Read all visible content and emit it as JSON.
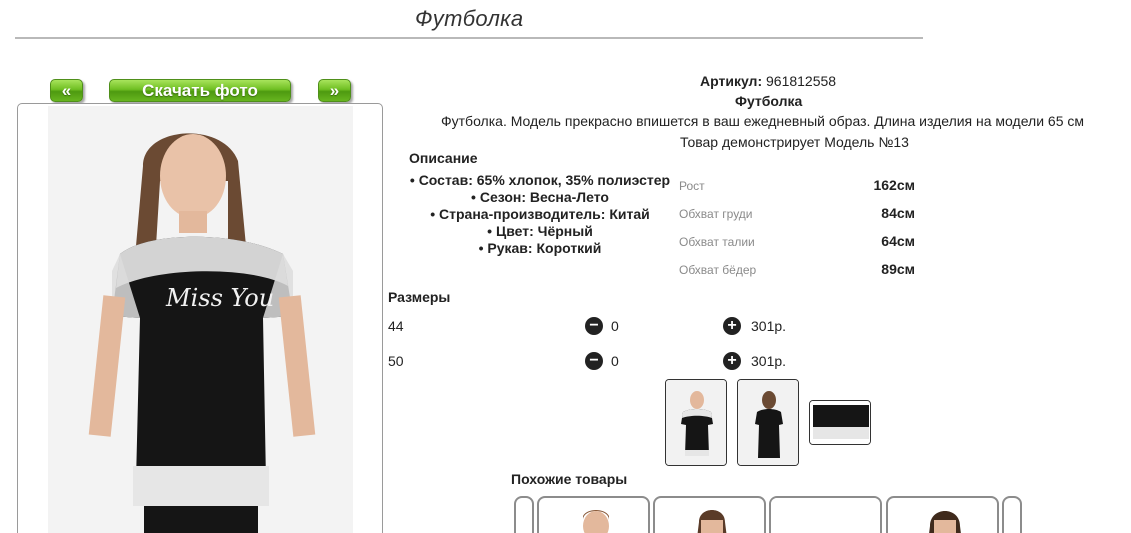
{
  "page": {
    "title": "Футболка"
  },
  "gallery": {
    "prev_label": "«",
    "download_label": "Скачать фото",
    "next_label": "»"
  },
  "product": {
    "article_label": "Артикул:",
    "article_value": "961812558",
    "name": "Футболка",
    "description": "Футболка. Модель прекрасно впишется в ваш ежедневный образ. Длина изделия на модели 65 см",
    "model_note": "Товар демонстрирует Модель №13"
  },
  "description_section": {
    "label": "Описание",
    "items": [
      "Состав: 65% хлопок, 35% полиэстер",
      "Сезон: Весна-Лето",
      "Страна-производитель: Китай",
      "Цвет: Чёрный",
      "Рукав: Короткий"
    ]
  },
  "measurements": [
    {
      "label": "Рост",
      "value": "162см"
    },
    {
      "label": "Обхват груди",
      "value": "84см"
    },
    {
      "label": "Обхват талии",
      "value": "64см"
    },
    {
      "label": "Обхват бёдер",
      "value": "89см"
    }
  ],
  "sizes": {
    "label": "Размеры",
    "minus_icon": "−",
    "plus_icon": "+",
    "rows": [
      {
        "size": "44",
        "qty": "0",
        "price": "301р."
      },
      {
        "size": "50",
        "qty": "0",
        "price": "301р."
      }
    ]
  },
  "thumbnails": [
    "front-view",
    "back-view",
    "detail-view"
  ],
  "similar": {
    "label": "Похожие товары"
  },
  "colors": {
    "button_green": "#6fbf22",
    "text_dark": "#222222",
    "muted_label": "#8a8a8a"
  }
}
